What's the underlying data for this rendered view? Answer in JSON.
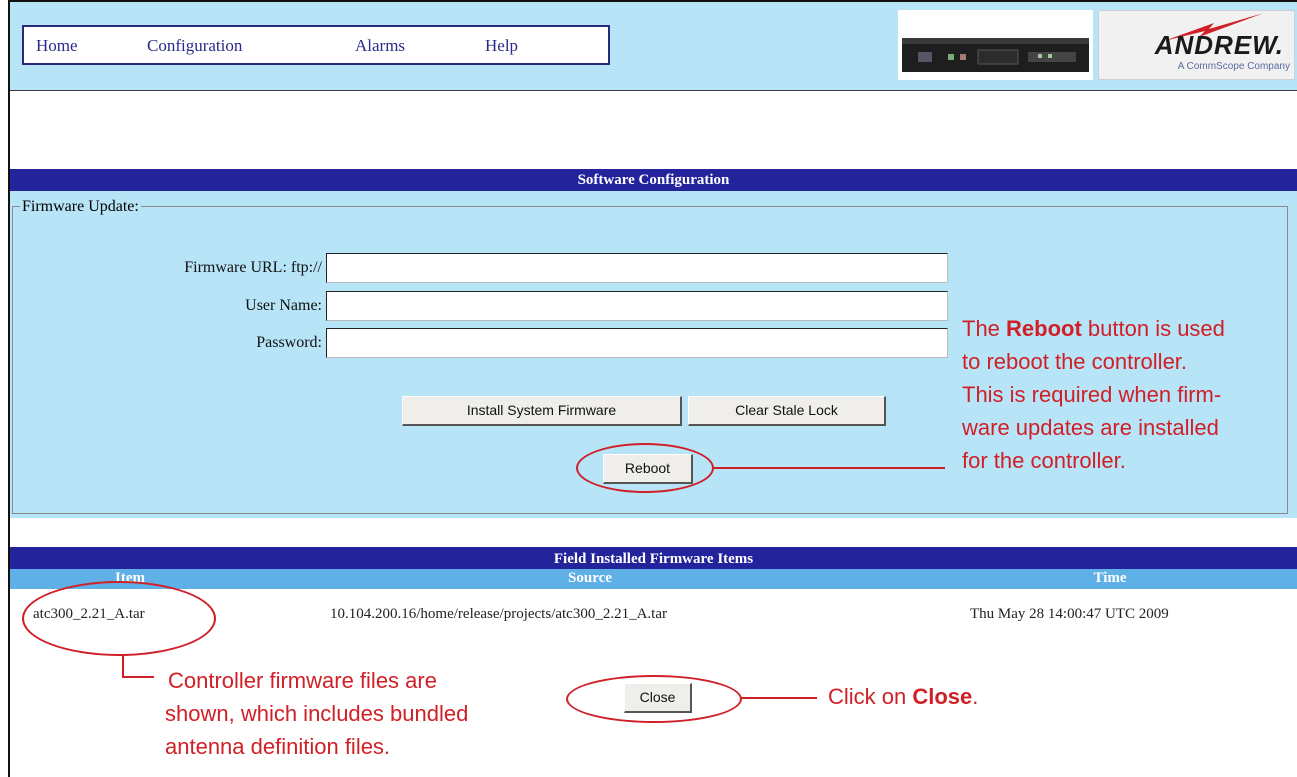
{
  "nav": {
    "items": [
      "Home",
      "Configuration",
      "Alarms",
      "Help"
    ]
  },
  "logo": {
    "brand": "ANDREW.",
    "subtitle": "A CommScope Company"
  },
  "software_config": {
    "title": "Software Configuration",
    "legend": "Firmware Update:",
    "fields": [
      {
        "label": "Firmware URL: ftp://",
        "value": ""
      },
      {
        "label": "User Name:",
        "value": ""
      },
      {
        "label": "Password:",
        "value": ""
      }
    ],
    "buttons": {
      "install": "Install System Firmware",
      "clear": "Clear Stale Lock",
      "reboot": "Reboot"
    }
  },
  "firmware_items": {
    "title": "Field Installed Firmware Items",
    "headers": [
      "Item",
      "Source",
      "Time"
    ],
    "rows": [
      {
        "item": "atc300_2.21_A.tar",
        "source": "10.104.200.16/home/release/projects/atc300_2.21_A.tar",
        "time": "Thu May 28 14:00:47 UTC 2009"
      }
    ],
    "close_label": "Close"
  },
  "annotations": {
    "reboot_lines": [
      {
        "pre": "The ",
        "bold": "Reboot",
        "post": " button is used"
      },
      {
        "pre": "to reboot the controller.",
        "bold": "",
        "post": ""
      },
      {
        "pre": "This is required when firm-",
        "bold": "",
        "post": ""
      },
      {
        "pre": "ware updates are installed",
        "bold": "",
        "post": ""
      },
      {
        "pre": "for the controller.",
        "bold": "",
        "post": ""
      }
    ],
    "files_lines": [
      "Controller firmware files are",
      "shown, which includes bundled",
      "antenna definition files."
    ],
    "close_note": {
      "pre": "Click on ",
      "bold": "Close",
      "post": "."
    }
  },
  "colors": {
    "panel": "#b7e4f7",
    "titlebar": "#23239b",
    "annotation": "#d01f26",
    "column_header": "#5fb0e6"
  }
}
